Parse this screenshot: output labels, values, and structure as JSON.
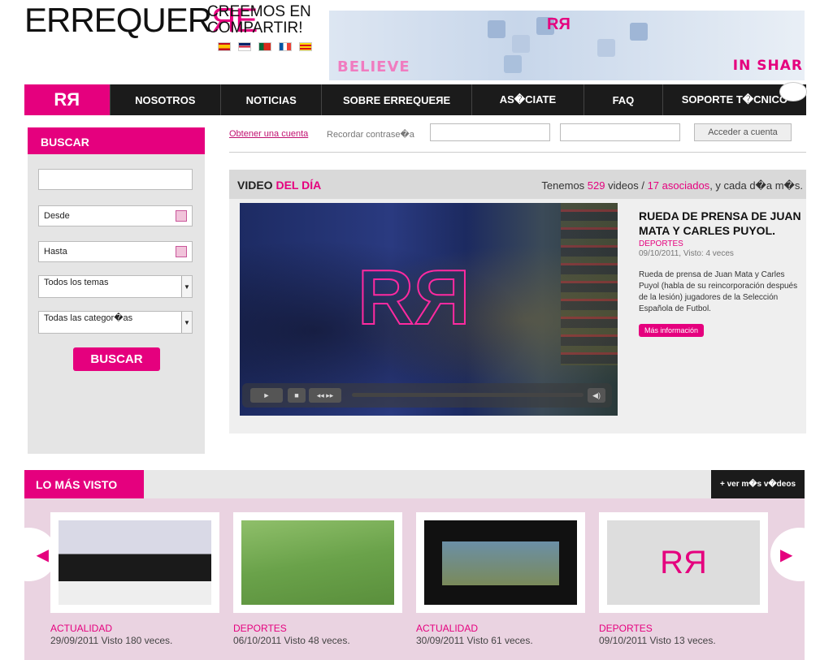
{
  "header": {
    "logo_left": "ERREQUER",
    "logo_right": "ЯE",
    "tagline": "CREEMOS EN COMPARTIR!",
    "banner_left": "BELIEVE",
    "banner_right": "IN SHAR",
    "flags": [
      "es-flag-icon",
      "uk-flag-icon",
      "pt-flag-icon",
      "fr-flag-icon",
      "ca-flag-icon"
    ]
  },
  "nav": {
    "home": "RЯ",
    "items": [
      "NOSOTROS",
      "NOTICIAS",
      "SOBRE ERREQUEЯE",
      "AS�CIATE",
      "FAQ",
      "SOPORTE T�CNICO"
    ]
  },
  "search": {
    "title": "BUSCAR",
    "from": "Desde",
    "to": "Hasta",
    "themes": "Todos los temas",
    "categories": "Todas las categor�as",
    "button": "BUSCAR"
  },
  "login": {
    "create": "Obtener una cuenta",
    "recover": "Recordar contrase�a",
    "button": "Acceder a cuenta"
  },
  "video": {
    "head_a": "VIDEO",
    "head_b": "DEL DÍA",
    "stats_a": "Tenemos",
    "stats_n": "529",
    "stats_b": "videos /",
    "stats_assoc": "17 asociados",
    "stats_c": ", y cada d�a m�s.",
    "title": "RUEDA DE PRENSA DE JUAN MATA Y CARLES PUYOL.",
    "category": "DEPORTES",
    "meta": "09/10/2011, Visto: 4 veces",
    "description": "Rueda de prensa de Juan Mata y Carles Puyol (habla de su reincorporación después de la lesión) jugadores de la Selección Española de Futbol.",
    "more": "Más información",
    "watermark": "RЯ"
  },
  "most_viewed": {
    "title": "LO MÁS VISTO",
    "more": "+ ver m�s v�deos",
    "items": [
      {
        "category": "ACTUALIDAD",
        "meta": "29/09/2011 Visto 180 veces."
      },
      {
        "category": "DEPORTES",
        "meta": "06/10/2011 Visto 48 veces."
      },
      {
        "category": "ACTUALIDAD",
        "meta": "30/09/2011 Visto 61 veces."
      },
      {
        "category": "DEPORTES",
        "meta": "09/10/2011 Visto 13 veces."
      }
    ],
    "placeholder_logo": "RЯ"
  },
  "colors": {
    "accent": "#e5007e",
    "nav": "#1b1b1b"
  }
}
